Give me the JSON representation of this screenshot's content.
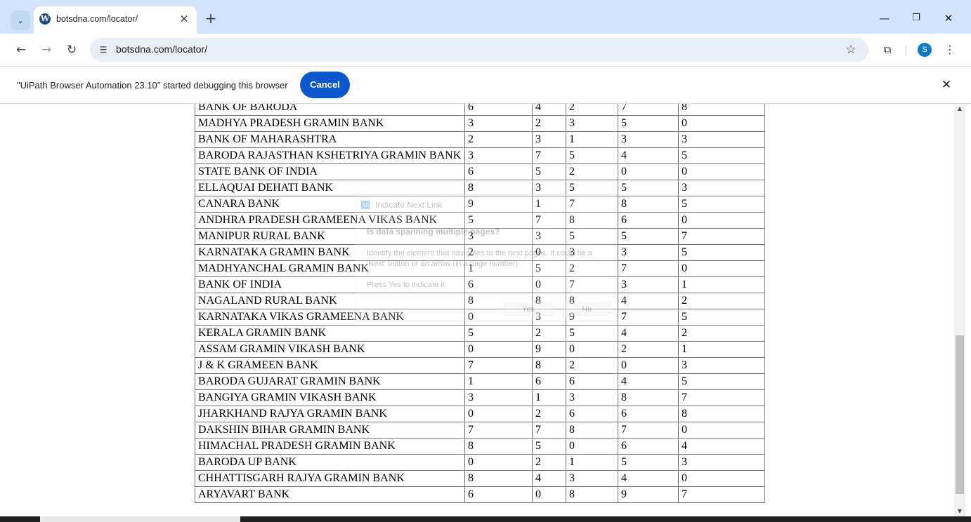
{
  "browser": {
    "tab_title": "botsdna.com/locator/",
    "url": "botsdna.com/locator/",
    "tab_search_glyph": "⌄",
    "new_tab_glyph": "+",
    "avatar_initial": "S"
  },
  "infobar": {
    "message": "\"UiPath Browser Automation 23.10\" started debugging this browser",
    "cancel_label": "Cancel"
  },
  "ghost_dialog": {
    "title": "Indicate Next Link",
    "heading": "Is data spanning multiple pages?",
    "line1": "Identify the element that navigates to the next pages. It could be a",
    "line2": "'Next' button or an arrow (in a page number)",
    "line3": "Press Yes to indicate it.",
    "yes_label": "Yes",
    "no_label": "No"
  },
  "table": {
    "rows": [
      [
        "BANK OF BARODA",
        "6",
        "4",
        "2",
        "7",
        "8"
      ],
      [
        "MADHYA PRADESH GRAMIN BANK",
        "3",
        "2",
        "3",
        "5",
        "0"
      ],
      [
        "BANK OF MAHARASHTRA",
        "2",
        "3",
        "1",
        "3",
        "3"
      ],
      [
        "BARODA RAJASTHAN KSHETRIYA GRAMIN BANK",
        "3",
        "7",
        "5",
        "4",
        "5"
      ],
      [
        "STATE BANK OF INDIA",
        "6",
        "5",
        "2",
        "0",
        "0"
      ],
      [
        "ELLAQUAI DEHATI BANK",
        "8",
        "3",
        "5",
        "5",
        "3"
      ],
      [
        "CANARA BANK",
        "9",
        "1",
        "7",
        "8",
        "5"
      ],
      [
        "ANDHRA PRADESH GRAMEENA VIKAS BANK",
        "5",
        "7",
        "8",
        "6",
        "0"
      ],
      [
        "MANIPUR RURAL BANK",
        "3",
        "3",
        "5",
        "5",
        "7"
      ],
      [
        "KARNATAKA GRAMIN BANK",
        "2",
        "0",
        "3",
        "3",
        "5"
      ],
      [
        "MADHYANCHAL GRAMIN BANK",
        "1",
        "5",
        "2",
        "7",
        "0"
      ],
      [
        "BANK OF INDIA",
        "6",
        "0",
        "7",
        "3",
        "1"
      ],
      [
        "NAGALAND RURAL BANK",
        "8",
        "8",
        "8",
        "4",
        "2"
      ],
      [
        "KARNATAKA VIKAS GRAMEENA BANK",
        "0",
        "3",
        "9",
        "7",
        "5"
      ],
      [
        "KERALA GRAMIN BANK",
        "5",
        "2",
        "5",
        "4",
        "2"
      ],
      [
        "ASSAM GRAMIN VIKASH BANK",
        "0",
        "9",
        "0",
        "2",
        "1"
      ],
      [
        "J & K GRAMEEN BANK",
        "7",
        "8",
        "2",
        "0",
        "3"
      ],
      [
        "BARODA GUJARAT GRAMIN BANK",
        "1",
        "6",
        "6",
        "4",
        "5"
      ],
      [
        "BANGIYA GRAMIN VIKASH BANK",
        "3",
        "1",
        "3",
        "8",
        "7"
      ],
      [
        "JHARKHAND RAJYA GRAMIN BANK",
        "0",
        "2",
        "6",
        "6",
        "8"
      ],
      [
        "DAKSHIN BIHAR GRAMIN BANK",
        "7",
        "7",
        "8",
        "7",
        "0"
      ],
      [
        "HIMACHAL PRADESH GRAMIN BANK",
        "8",
        "5",
        "0",
        "6",
        "4"
      ],
      [
        "BARODA UP BANK",
        "0",
        "2",
        "1",
        "5",
        "3"
      ],
      [
        "CHHATTISGARH RAJYA GRAMIN BANK",
        "8",
        "4",
        "3",
        "4",
        "0"
      ],
      [
        "ARYAVART BANK",
        "6",
        "0",
        "8",
        "9",
        "7"
      ]
    ]
  }
}
